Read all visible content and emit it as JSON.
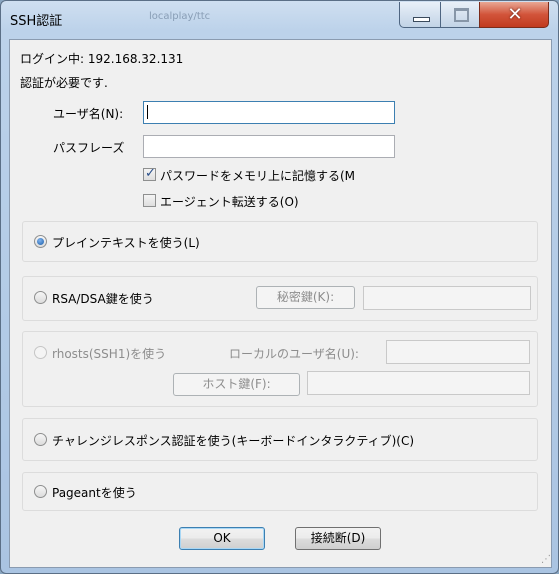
{
  "window": {
    "title": "SSH認証",
    "background_title": "localplay/ttc"
  },
  "status": {
    "logging_in": "ログイン中: 192.168.32.131",
    "auth_required": "認証が必要です."
  },
  "form": {
    "username_label": "ユーザ名(N):",
    "username_value": "",
    "passphrase_label": "パスフレーズ",
    "passphrase_value": "",
    "remember_password_label": "パスワードをメモリ上に記憶する(M",
    "remember_password_checked": true,
    "agent_forward_label": "エージェント転送する(O)",
    "agent_forward_checked": false
  },
  "methods": {
    "plaintext_label": "プレインテキストを使う(L)",
    "rsa_label": "RSA/DSA鍵を使う",
    "private_key_button": "秘密鍵(K):",
    "rhosts_label": "rhosts(SSH1)を使う",
    "local_user_label": "ローカルのユーザ名(U):",
    "host_key_button": "ホスト鍵(F):",
    "challenge_label": "チャレンジレスポンス認証を使う(キーボードインタラクティブ)(C)",
    "pageant_label": "Pageantを使う",
    "selected": "plaintext"
  },
  "buttons": {
    "ok": "OK",
    "disconnect": "接続断(D)"
  },
  "colors": {
    "titlebar": "#bcd2ea",
    "close_button": "#c8462b",
    "client_bg": "#f0f0f0",
    "focus_border": "#3c7fb1"
  },
  "icons": {
    "minimize": "minimize-icon",
    "maximize": "maximize-icon",
    "close": "close-icon"
  }
}
